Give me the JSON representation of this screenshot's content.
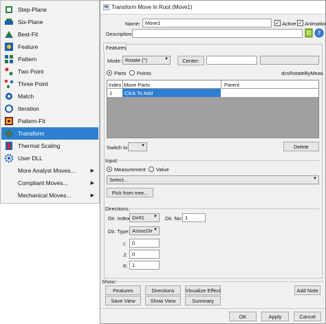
{
  "menu": {
    "items": [
      {
        "label": "Step-Plane",
        "icon": "step-plane-icon",
        "selected": false,
        "submenu": false
      },
      {
        "label": "Six-Plane",
        "icon": "six-plane-icon",
        "selected": false,
        "submenu": false
      },
      {
        "label": "Best-Fit",
        "icon": "best-fit-icon",
        "selected": false,
        "submenu": false
      },
      {
        "label": "Feature",
        "icon": "feature-icon",
        "selected": false,
        "submenu": false
      },
      {
        "label": "Pattern",
        "icon": "pattern-icon",
        "selected": false,
        "submenu": false
      },
      {
        "label": "Two Point",
        "icon": "two-point-icon",
        "selected": false,
        "submenu": false
      },
      {
        "label": "Three Point",
        "icon": "three-point-icon",
        "selected": false,
        "submenu": false
      },
      {
        "label": "Match",
        "icon": "match-icon",
        "selected": false,
        "submenu": false
      },
      {
        "label": "Iteration",
        "icon": "iteration-icon",
        "selected": false,
        "submenu": false
      },
      {
        "label": "Pattern-Fit",
        "icon": "pattern-fit-icon",
        "selected": false,
        "submenu": false
      },
      {
        "label": "Transform",
        "icon": "transform-icon",
        "selected": true,
        "submenu": false
      },
      {
        "label": "Thermal Scaling",
        "icon": "thermal-scaling-icon",
        "selected": false,
        "submenu": false
      },
      {
        "label": "User DLL",
        "icon": "user-dll-icon",
        "selected": false,
        "submenu": false
      },
      {
        "label": "More Analyst Moves...",
        "icon": "",
        "selected": false,
        "submenu": true
      },
      {
        "label": "Compliant Moves...",
        "icon": "",
        "selected": false,
        "submenu": true
      },
      {
        "label": "Mechanical Moves...",
        "icon": "",
        "selected": false,
        "submenu": true
      }
    ],
    "selected_color": "#2f7fd1"
  },
  "dialog": {
    "title": "Transform Move In Root (Move1)",
    "name_label": "Name:",
    "name_value": "Move1",
    "active_label": "Active",
    "animation_label": "Animation",
    "description_label": "Description:",
    "description_value": "",
    "features_tab": "Features",
    "mode_label": "Mode:",
    "mode_value": "Rotate (°)",
    "center_label": "Center:",
    "parts_label": "Parts",
    "points_label": "Points",
    "routine_name": "dcsRotateByMeas",
    "table": {
      "headers": [
        "Index",
        "Move Parts",
        "Parent"
      ],
      "rows": [
        {
          "index": "1",
          "move_parts": "Click To Add",
          "parent": ""
        }
      ]
    },
    "switch_to_label": "Switch to:",
    "delete_label": "Delete",
    "input_label": "Input:",
    "measurement_label": "Measurement",
    "value_label": "Value",
    "select_value": "Select...",
    "pick_label": "Pick from tree...",
    "directions_label": "Directions:",
    "dir_index_label": "Dir. Index:",
    "dir_index_value": "Dir#1",
    "dir_no_label": "Dir. No:",
    "dir_no_value": "1",
    "dir_type_label": "Dir. Type:",
    "dir_type_value": "AssocDir",
    "i_label": "I:",
    "i_value": "0",
    "j_label": "J:",
    "j_value": "0",
    "k_label": "K:",
    "k_value": "1",
    "show_label": "Show:",
    "buttons": {
      "features": "Features",
      "directions": "Directions",
      "visualize": "Visualize Effect",
      "save_view": "Save View",
      "show_view": "Show View",
      "summary": "Summary",
      "add_note": "Add Note",
      "ok": "OK",
      "apply": "Apply",
      "cancel": "Cancel"
    }
  }
}
